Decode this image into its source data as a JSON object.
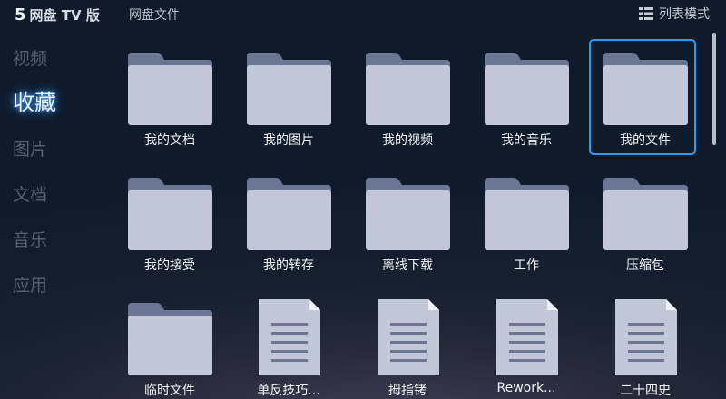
{
  "header": {
    "brand_logo": "5",
    "brand_text": "网盘 TV 版",
    "breadcrumb": "网盘文件",
    "view_toggle_label": "列表模式",
    "view_toggle_icon": "list-mode-icon"
  },
  "sidebar": {
    "items": [
      {
        "label": "视频",
        "active": false
      },
      {
        "label": "收藏",
        "active": true
      },
      {
        "label": "图片",
        "active": false
      },
      {
        "label": "文档",
        "active": false
      },
      {
        "label": "音乐",
        "active": false
      },
      {
        "label": "应用",
        "active": false
      }
    ]
  },
  "files": [
    {
      "name": "我的文档",
      "type": "folder"
    },
    {
      "name": "我的图片",
      "type": "folder"
    },
    {
      "name": "我的视频",
      "type": "folder"
    },
    {
      "name": "我的音乐",
      "type": "folder"
    },
    {
      "name": "我的文件",
      "type": "folder",
      "selected": true
    },
    {
      "name": "我的接受",
      "type": "folder"
    },
    {
      "name": "我的转存",
      "type": "folder"
    },
    {
      "name": "离线下载",
      "type": "folder"
    },
    {
      "name": "工作",
      "type": "folder"
    },
    {
      "name": "压缩包",
      "type": "folder"
    },
    {
      "name": "临时文件",
      "type": "folder"
    },
    {
      "name": "单反技巧...",
      "type": "document"
    },
    {
      "name": "拇指铐",
      "type": "document"
    },
    {
      "name": "Rework...",
      "type": "document"
    },
    {
      "name": "二十四史",
      "type": "document"
    }
  ],
  "colors": {
    "folder_body": "#c3c8d9",
    "folder_tab": "#6b7693",
    "doc_body": "#c3c8d9",
    "doc_lines": "#6b7693",
    "focus_ring": "#2f9cf3",
    "sidebar_active_glow": "#4fa3ff"
  }
}
